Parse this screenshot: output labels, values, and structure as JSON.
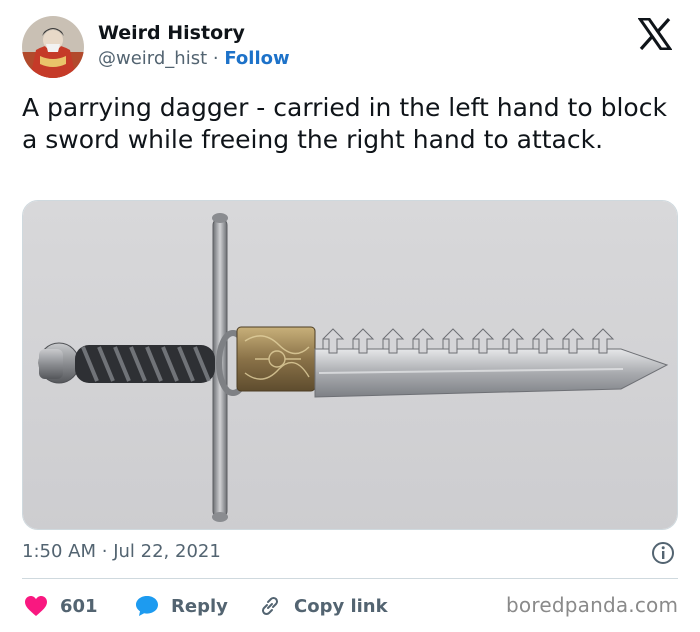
{
  "author": {
    "display_name": "Weird History",
    "handle": "@weird_hist",
    "separator": "·",
    "follow_label": "Follow"
  },
  "tweet": {
    "text": "A parrying dagger - carried in the left hand to block a sword while freeing the right hand to attack.",
    "time": "1:50 AM",
    "date_separator": "·",
    "date": "Jul 22, 2021"
  },
  "actions": {
    "likes_count": "601",
    "reply_label": "Reply",
    "copy_link_label": "Copy link"
  },
  "watermark": "boredpanda.com",
  "icons": {
    "platform": "x-logo-icon",
    "like": "heart-icon",
    "reply": "speech-bubble-icon",
    "copy": "link-icon",
    "info": "info-icon"
  },
  "colors": {
    "text": "#0f1419",
    "secondary": "#536471",
    "follow": "#1d72c9",
    "like": "#f91880",
    "reply": "#1d9bf0",
    "divider": "#cfd9de",
    "image_background": "#d3d3d6"
  }
}
